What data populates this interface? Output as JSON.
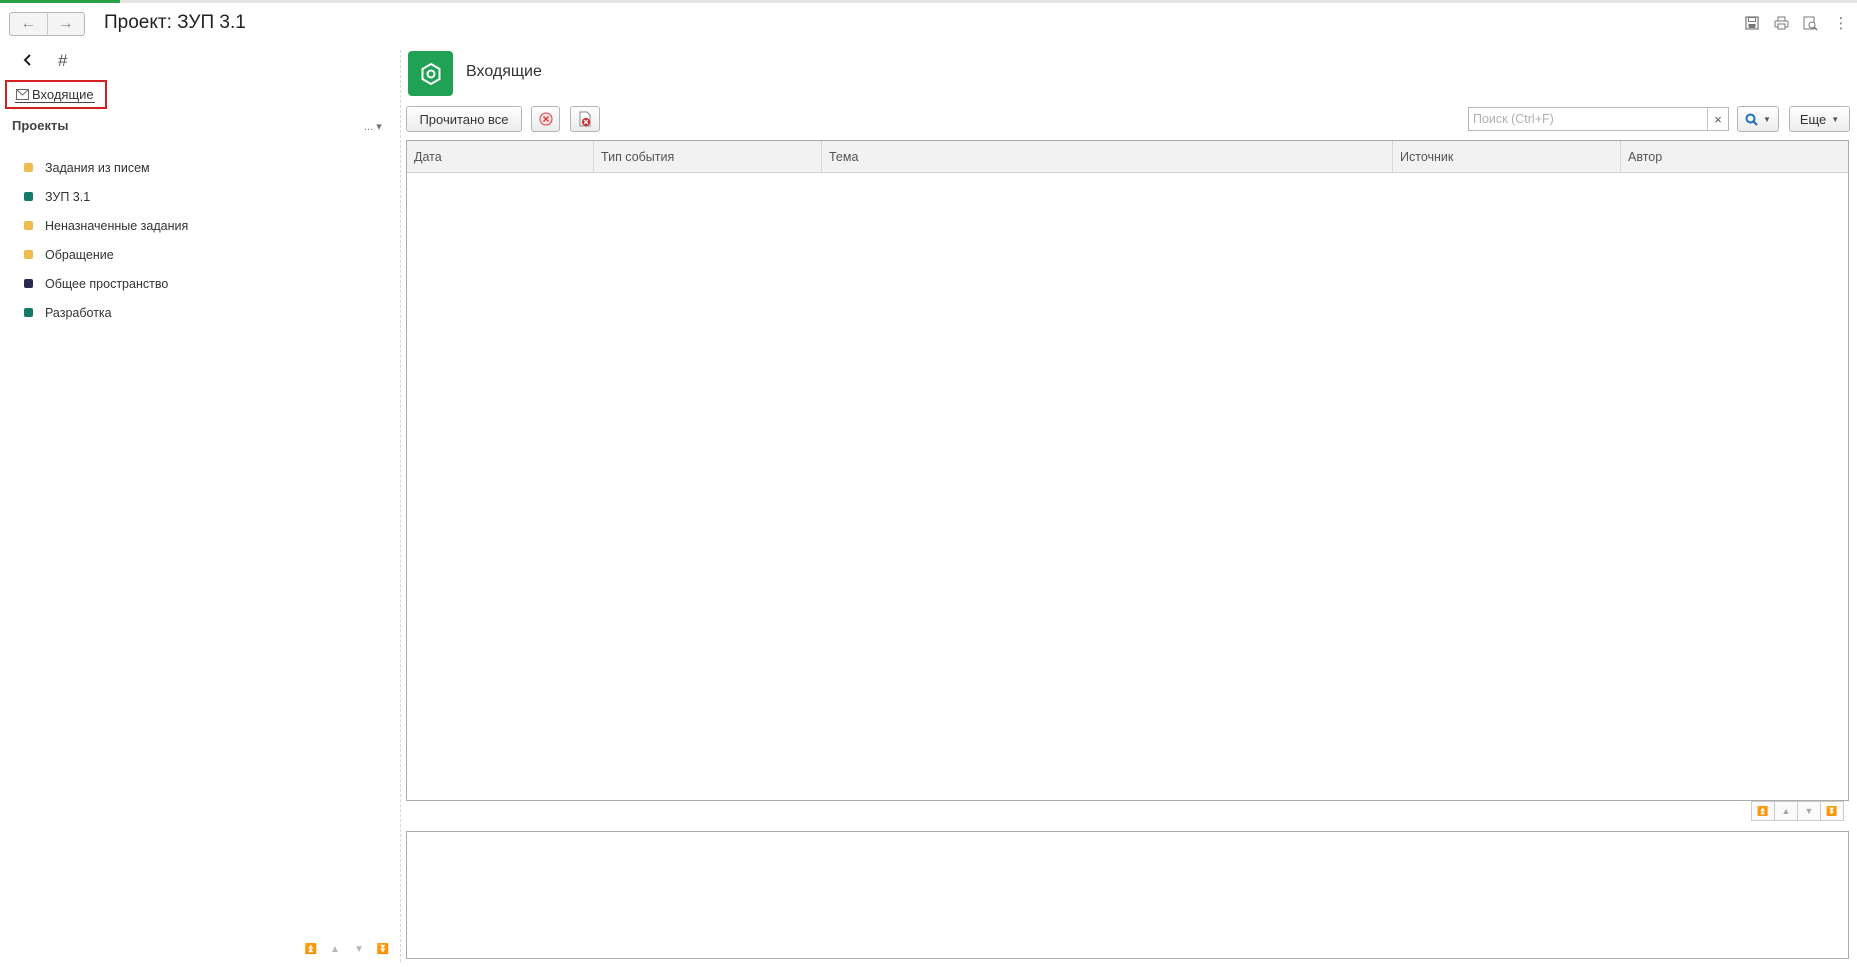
{
  "window": {
    "title": "Проект: ЗУП 3.1",
    "nav": {
      "back": "←",
      "forward": "→"
    },
    "toolbar_icons": [
      "save-icon",
      "print-icon",
      "preview-icon",
      "menu-kebab-icon"
    ],
    "menu_glyph": "⋮"
  },
  "sidebar": {
    "hash": "#",
    "inbox_label": "Входящие",
    "projects_title": "Проекты",
    "projects_more": "... ▾",
    "projects": [
      {
        "label": "Задания из писем",
        "color": "#f0bb4e"
      },
      {
        "label": "ЗУП 3.1",
        "color": "#167a6a"
      },
      {
        "label": "Неназначенные задания",
        "color": "#f0bb4e"
      },
      {
        "label": "Обращение",
        "color": "#f0bb4e"
      },
      {
        "label": "Общее пространство",
        "color": "#2a2a4e"
      },
      {
        "label": "Разработка",
        "color": "#167a6a"
      }
    ]
  },
  "main": {
    "section_title": "Входящие",
    "accent_color": "#21a153",
    "toolbar": {
      "read_all": "Прочитано все",
      "search_placeholder": "Поиск (Ctrl+F)",
      "clear": "×",
      "more": "Еще"
    },
    "table": {
      "columns": [
        "Дата",
        "Тип события",
        "Тема",
        "Источник",
        "Автор"
      ],
      "rows": []
    }
  },
  "scroll_glyphs": {
    "first": "⏫",
    "up": "▲",
    "down": "▼",
    "last": "⏬"
  }
}
